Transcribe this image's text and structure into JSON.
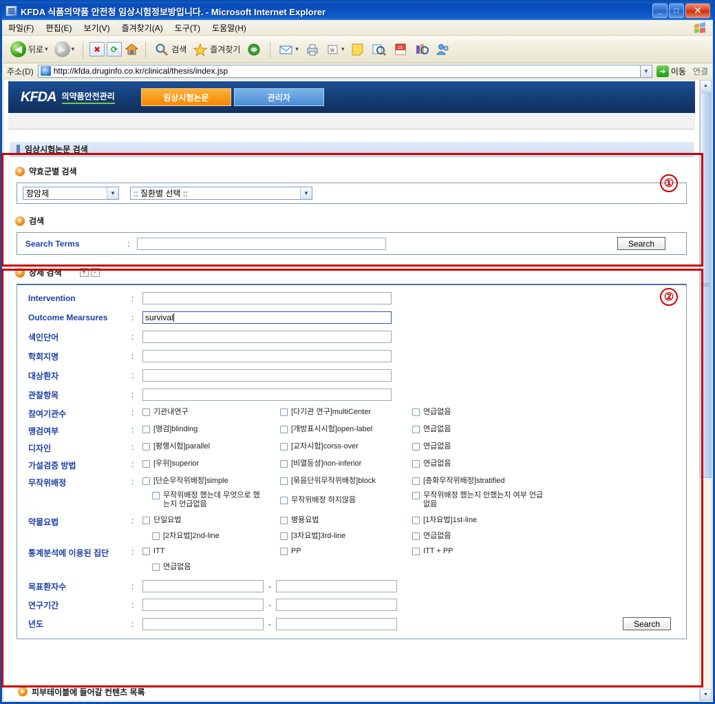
{
  "window": {
    "title": "KFDA 식품의약품 안전청 임상시험정보방입니다. - Microsoft Internet Explorer",
    "minimize": "_",
    "maximize": "□",
    "close": "✕"
  },
  "menubar": {
    "items": [
      "파일(F)",
      "편집(E)",
      "보기(V)",
      "즐겨찾기(A)",
      "도구(T)",
      "도움말(H)"
    ]
  },
  "toolbar": {
    "back": "뒤로",
    "forward": "",
    "stop_icon": "✖",
    "refresh_icon": "⟳",
    "home_icon": "⌂",
    "search": "검색",
    "favorites": "즐겨찾기",
    "media_icon": "media-icon",
    "mail_icon": "mail-icon",
    "print_icon": "print-icon",
    "edit_icon": "edit-icon",
    "note_icon": "note-icon",
    "research_icon": "research-icon",
    "msn_icon": "msn-icon",
    "messenger_icon": "messenger-icon",
    "dropdown_caret": "▾"
  },
  "address": {
    "label": "주소(D)",
    "url": "http://kfda.druginfo.co.kr/clinical/thesis/index.jsp",
    "go": "이동",
    "links": "연결"
  },
  "site": {
    "logo": "KFDA",
    "logo_sub": "의약품안전관리",
    "tabs": [
      {
        "label": "임상시험논문",
        "active": true
      },
      {
        "label": "관리자",
        "active": false
      }
    ]
  },
  "section1": {
    "header": "임상시험논문 검색",
    "group_drug": "약효군별 검색",
    "select_drug_class": "항암제",
    "select_disease": ":: 질환별 선택 ::",
    "group_search": "검색",
    "search_terms_label": "Search Terms",
    "colon": ":",
    "search_terms_value": "",
    "search_button": "Search",
    "marker": "①"
  },
  "section2": {
    "group_detail": "상세 검색",
    "expand": "+",
    "collapse": "-",
    "marker": "②",
    "colon": ":",
    "text_fields": [
      {
        "label": "Intervention",
        "value": ""
      },
      {
        "label": "Outcome Mearsures",
        "value": "survival"
      },
      {
        "label": "색인단어",
        "value": ""
      },
      {
        "label": "학회지명",
        "value": ""
      },
      {
        "label": "대상환자",
        "value": ""
      },
      {
        "label": "관찰항목",
        "value": ""
      }
    ],
    "checkbox_rows": [
      {
        "label": "참여기관수",
        "options": [
          [
            "기관내연구",
            "[다기관 연구]multiCenter",
            "연급없음"
          ]
        ]
      },
      {
        "label": "맹검여부",
        "options": [
          [
            "[맹검]blinding",
            "[개방표시시험]open-label",
            "연급없음"
          ]
        ]
      },
      {
        "label": "디자인",
        "options": [
          [
            "[평행시험]parallel",
            "[교차시험]corss-over",
            "연급없음"
          ]
        ]
      },
      {
        "label": "가설검증 방법",
        "options": [
          [
            "[우위]superior",
            "[비열등성]non-inferior",
            "연급없음"
          ]
        ]
      },
      {
        "label": "무작위배정",
        "options": [
          [
            "[단순무작위배정]simple",
            "[묶음단위무작위배정]block",
            "[층화무작위배정]stratified"
          ],
          [
            "무작위배정 했는데 무엇으로 했는지 언급없음",
            "무작위배정 하지않음",
            "무작위배정 했는지 안했는지 여부 언급없음"
          ]
        ]
      },
      {
        "label": "약물요법",
        "options": [
          [
            "단일요법",
            "병용요법",
            "[1차요법]1st-line"
          ],
          [
            "[2차요법]2nd-line",
            "[3차요법]3rd-line",
            "연급없음"
          ]
        ]
      },
      {
        "label": "통계분석에 이용된 집단",
        "options": [
          [
            "ITT",
            "PP",
            "ITT + PP"
          ],
          [
            "연급없음",
            "",
            ""
          ]
        ]
      }
    ],
    "range_rows": [
      {
        "label": "목표환자수",
        "from": "",
        "to": "",
        "dash": "-"
      },
      {
        "label": "연구기간",
        "from": "",
        "to": "",
        "dash": "-"
      },
      {
        "label": "년도",
        "from": "",
        "to": "",
        "dash": "-"
      }
    ],
    "search_button": "Search"
  },
  "section3": {
    "header": "피부테이블에 들어갈 컨텐츠 목록"
  },
  "colors": {
    "annotation_red": "#cc0000",
    "label_blue": "#1a3fa8",
    "tab_active": "#f58700",
    "tab_inactive": "#4a8ed4",
    "banner_navy": "#143c74"
  }
}
